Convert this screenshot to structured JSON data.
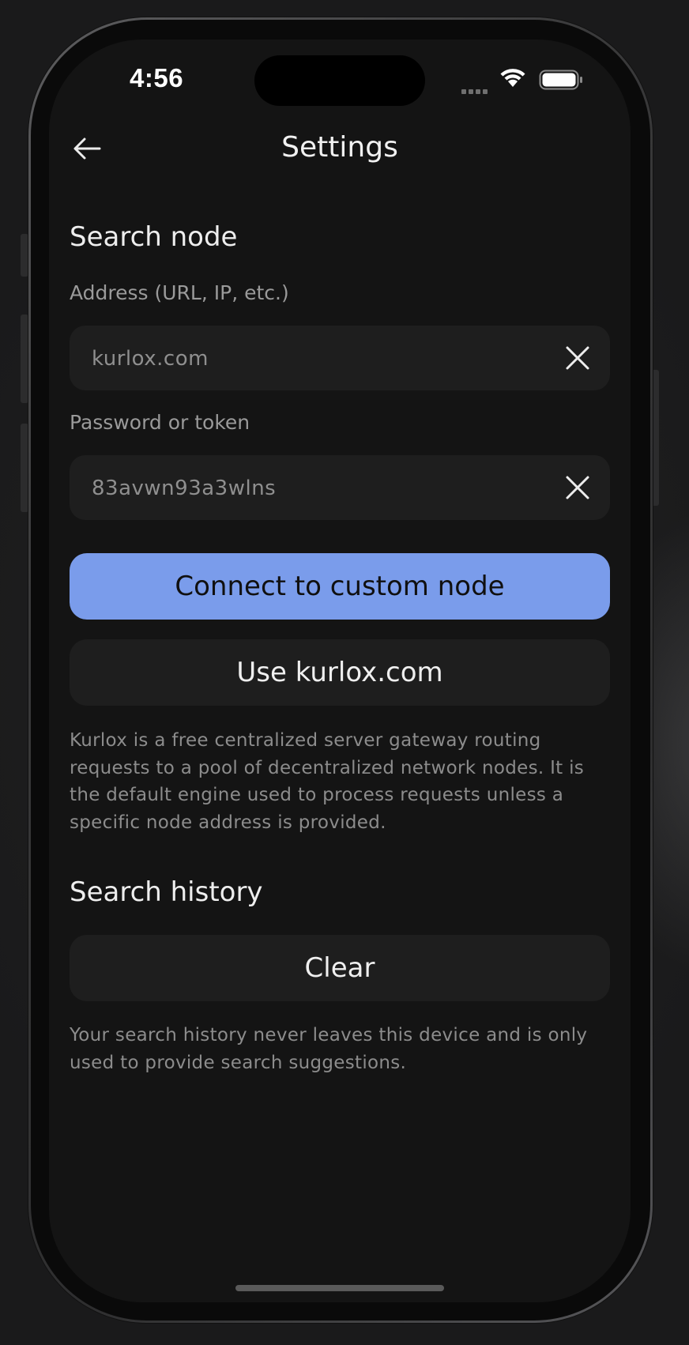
{
  "status_bar": {
    "time": "4:56"
  },
  "nav": {
    "title": "Settings",
    "back_icon": "arrow-left-icon"
  },
  "search_node": {
    "title": "Search node",
    "address": {
      "label": "Address (URL, IP, etc.)",
      "value": "kurlox.com",
      "clear_icon": "close-icon"
    },
    "password": {
      "label": "Password or token",
      "value": "83avwn93a3wlns",
      "clear_icon": "close-icon"
    },
    "connect_button": "Connect to custom node",
    "use_default_button": "Use kurlox.com",
    "description": "Kurlox is a free centralized server gateway routing requests to a pool of decentralized network nodes. It is the default engine used to process requests unless a specific node address is provided."
  },
  "search_history": {
    "title": "Search history",
    "clear_button": "Clear",
    "description": "Your search history never leaves this device and is only used to provide search suggestions."
  },
  "colors": {
    "accent": "#7a9ceb",
    "background": "#141414",
    "field": "#1e1e1e"
  }
}
